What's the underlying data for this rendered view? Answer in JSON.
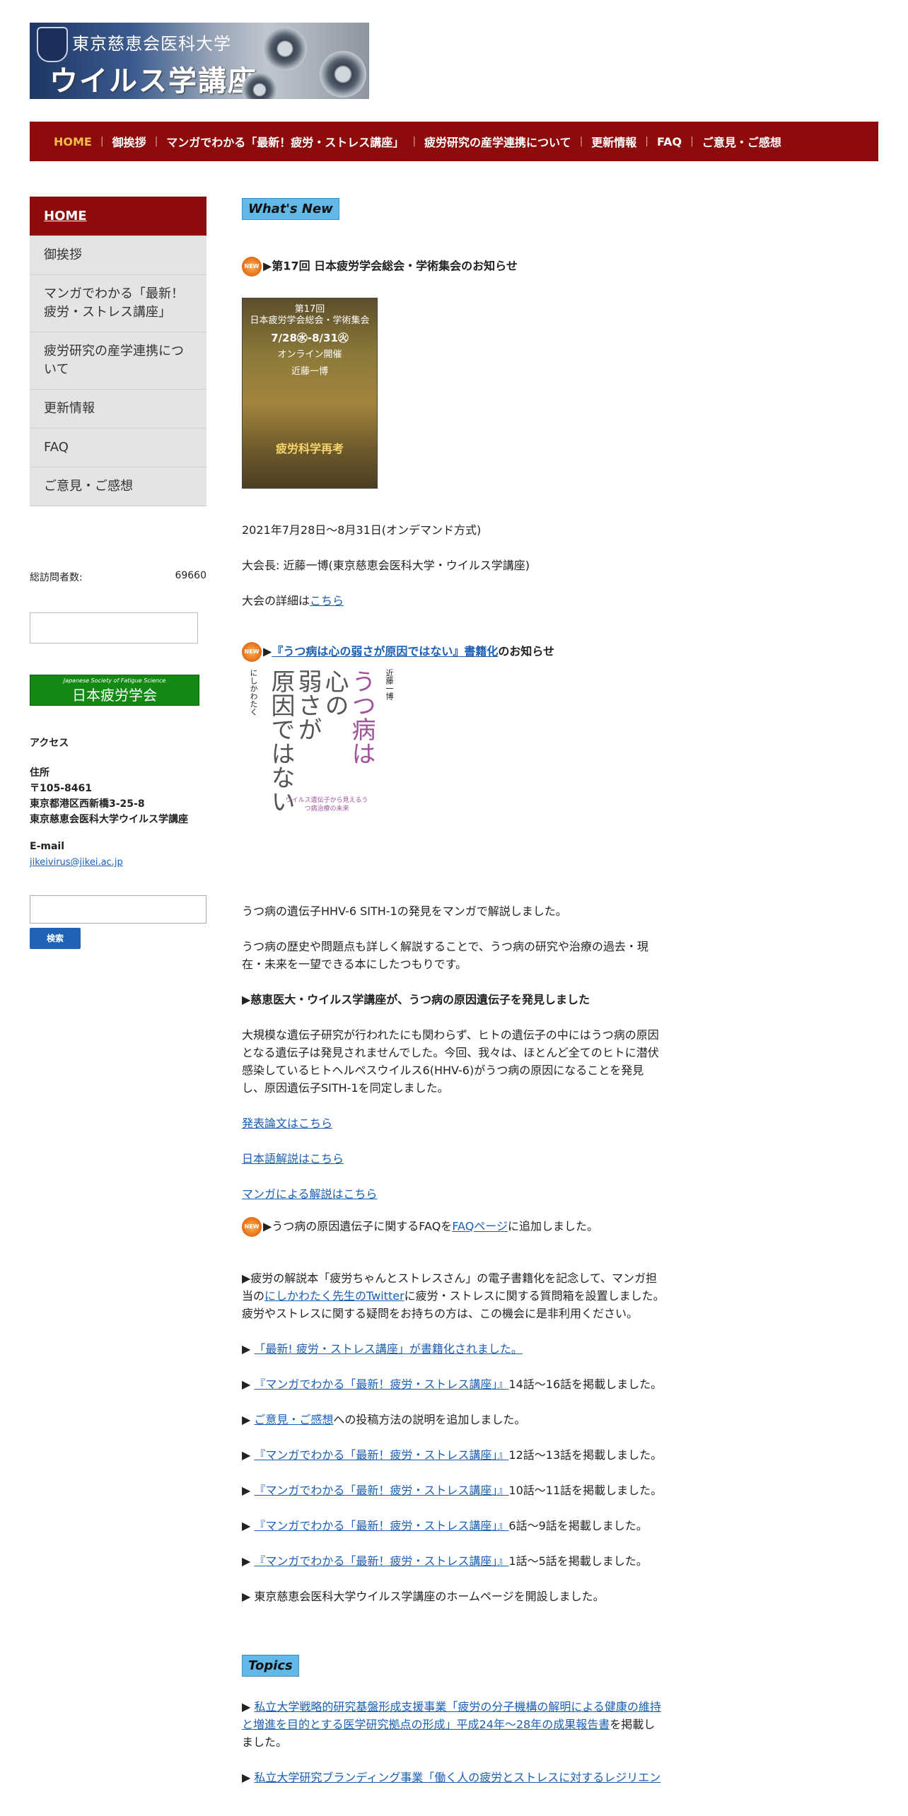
{
  "banner": {
    "line1": "東京慈恵会医科大学",
    "line2": "ウイルス学講座"
  },
  "nav": {
    "items": [
      "HOME",
      "御挨拶",
      "マンガでわかる「最新！疲労・ストレス講座」",
      "疲労研究の産学連携について",
      "更新情報",
      "FAQ",
      "ご意見・ご感想"
    ],
    "separator": "|"
  },
  "sidebar": {
    "menu": [
      "HOME",
      "御挨拶",
      "マンガでわかる「最新！疲労・ストレス講座」",
      "疲労研究の産学連携について",
      "更新情報",
      "FAQ",
      "ご意見・ご感想"
    ],
    "counter_label": "総訪問者数:",
    "counter_value": "69660",
    "society_en": "Japanese Society of Fatigue Science",
    "society_jp": "日本疲労学会",
    "access_label": "アクセス",
    "address_label": "住所",
    "postal": "〒105-8461",
    "address1": "東京都港区西新橋3-25-8",
    "address2": "東京慈恵会医科大学ウイルス学講座",
    "email_label": "E-mail",
    "email": "jikeivirus@jikei.ac.jp",
    "search_button": "検索"
  },
  "main": {
    "whats_new": "What's New",
    "topics": "Topics",
    "news1_title": "▶第17回 日本疲労学会総会・学術集会のお知らせ",
    "poster_line1": "第17回",
    "poster_line2": "日本疲労学会総会・学術集会",
    "poster_dates": "7/28㊌-8/31㊋",
    "poster_mode": "オンライン開催",
    "poster_chair": "近藤一博",
    "poster_theme": "疲労科学再考",
    "news1_date": "2021年7月28日～8月31日(オンデマンド方式)",
    "news1_chair": "大会長: 近藤一博(東京慈恵会医科大学・ウイルス学講座)",
    "news1_detail_prefix": "大会の詳細は",
    "news1_detail_link": "こちら",
    "news2_prefix": "▶",
    "news2_link": "『うつ病は心の弱さが原因ではない』書籍化",
    "news2_suffix": "のお知らせ",
    "book_title_a": "うつ病は",
    "book_title_b": "心の",
    "book_title_c": "弱さが",
    "book_title_d": "原因ではない",
    "book_author": "近藤一博",
    "book_manga": "にしかわたく",
    "book_sub": "ウイルス遺伝子から見えるうつ病治療の未来",
    "p1": "うつ病の遺伝子HHV-6 SITH-1の発見をマンガで解説しました。",
    "p2": "うつ病の歴史や問題点も詳しく解説することで、うつ病の研究や治療の過去・現在・未来を一望できる本にしたつもりです。",
    "p3": "▶慈恵医大・ウイルス学講座が、うつ病の原因遺伝子を発見しました",
    "p4": "大規模な遺伝子研究が行われたにも関わらず、ヒトの遺伝子の中にはうつ病の原因となる遺伝子は発見されませんでした。今回、我々は、ほとんど全てのヒトに潜伏感染しているヒトヘルペスウイルス6(HHV-6)がうつ病の原因になることを発見し、原因遺伝子SITH-1を同定しました。",
    "link1": "発表論文はこちら",
    "link2": "日本語解説はこちら",
    "link3": "マンガによる解説はこちら",
    "faq_prefix": "▶うつ病の原因遺伝子に関するFAQを",
    "faq_link": "FAQページ",
    "faq_suffix": "に追加しました。",
    "ebook_a": "▶疲労の解説本「疲労ちゃんとストレスさん」の電子書籍化を記念して、マンガ担当の",
    "ebook_link": "にしかわたく先生のTwitter",
    "ebook_b": "に疲労・ストレスに関する質問箱を設置しました。疲労やストレスに関する疑問をお持ちの方は、この機会に是非利用ください。",
    "u1_link": "「最新! 疲労・ストレス講座」が書籍化されました。",
    "u2_link": "『マンガでわかる「最新！疲労・ストレス講座」』",
    "u2_text": "14話〜16話を掲載しました。",
    "u3_link": "ご意見・ご感想",
    "u3_text": "への投稿方法の説明を追加しました。",
    "u4_text": "12話〜13話を掲載しました。",
    "u5_text": "10話〜11話を掲載しました。",
    "u6_text": "6話〜9話を掲載しました。",
    "u7_text": "1話〜5話を掲載しました。",
    "u8_text": "▶ 東京慈恵会医科大学ウイルス学講座のホームページを開設しました。",
    "t1_link": "私立大学戦略的研究基盤形成支援事業「疲労の分子機構の解明による健康の維持と増進を目的とする医学研究拠点の形成」平成24年〜28年の成果報告書",
    "t1_suffix": "を掲載しました。",
    "t2_link": "私立大学研究ブランディング事業「働く人の疲労とストレスに対するレジリエン"
  }
}
